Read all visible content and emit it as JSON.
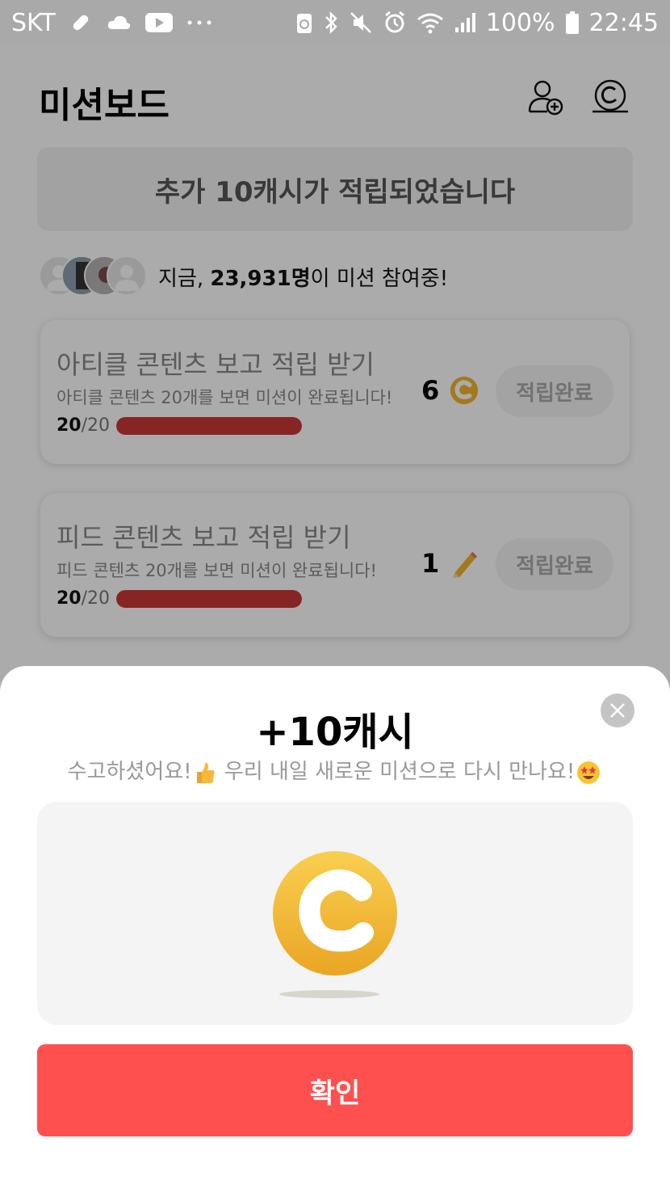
{
  "status_bar": {
    "carrier": "SKT",
    "battery": "100%",
    "time": "22:45"
  },
  "header": {
    "title": "미션보드",
    "add_friend_icon": "person-add-icon",
    "cash_icon": "cash-coin-icon"
  },
  "banner": {
    "text": "추가 10캐시가 적립되었습니다"
  },
  "participants": {
    "prefix": "지금, ",
    "count": "23,931명",
    "suffix": "이 미션 참여중!"
  },
  "missions": [
    {
      "title": "아티클 콘텐츠 보고 적립 받기",
      "description": "아티클 콘텐츠 20개를 보면 미션이 완료됩니다!",
      "progress_done": "20",
      "progress_total": "/20",
      "progress_fraction": 1.0,
      "reward": "6",
      "reward_icon": "coin-icon",
      "button": "적립완료"
    },
    {
      "title": "피드 콘텐츠 보고 적립 받기",
      "description": "피드 콘텐츠 20개를 보면 미션이 완료됩니다!",
      "progress_done": "20",
      "progress_total": "/20",
      "progress_fraction": 1.0,
      "reward": "1",
      "reward_icon": "pencil-icon",
      "button": "적립완료"
    }
  ],
  "sheet": {
    "title": "+10캐시",
    "subtitle_part1": "수고하셨어요!",
    "subtitle_part2": " 우리 내일 새로운 미션으로 다시 만나요!",
    "confirm": "확인"
  },
  "colors": {
    "accent": "#ff5050",
    "progress": "#c93737",
    "coin": "#f3b52c"
  }
}
